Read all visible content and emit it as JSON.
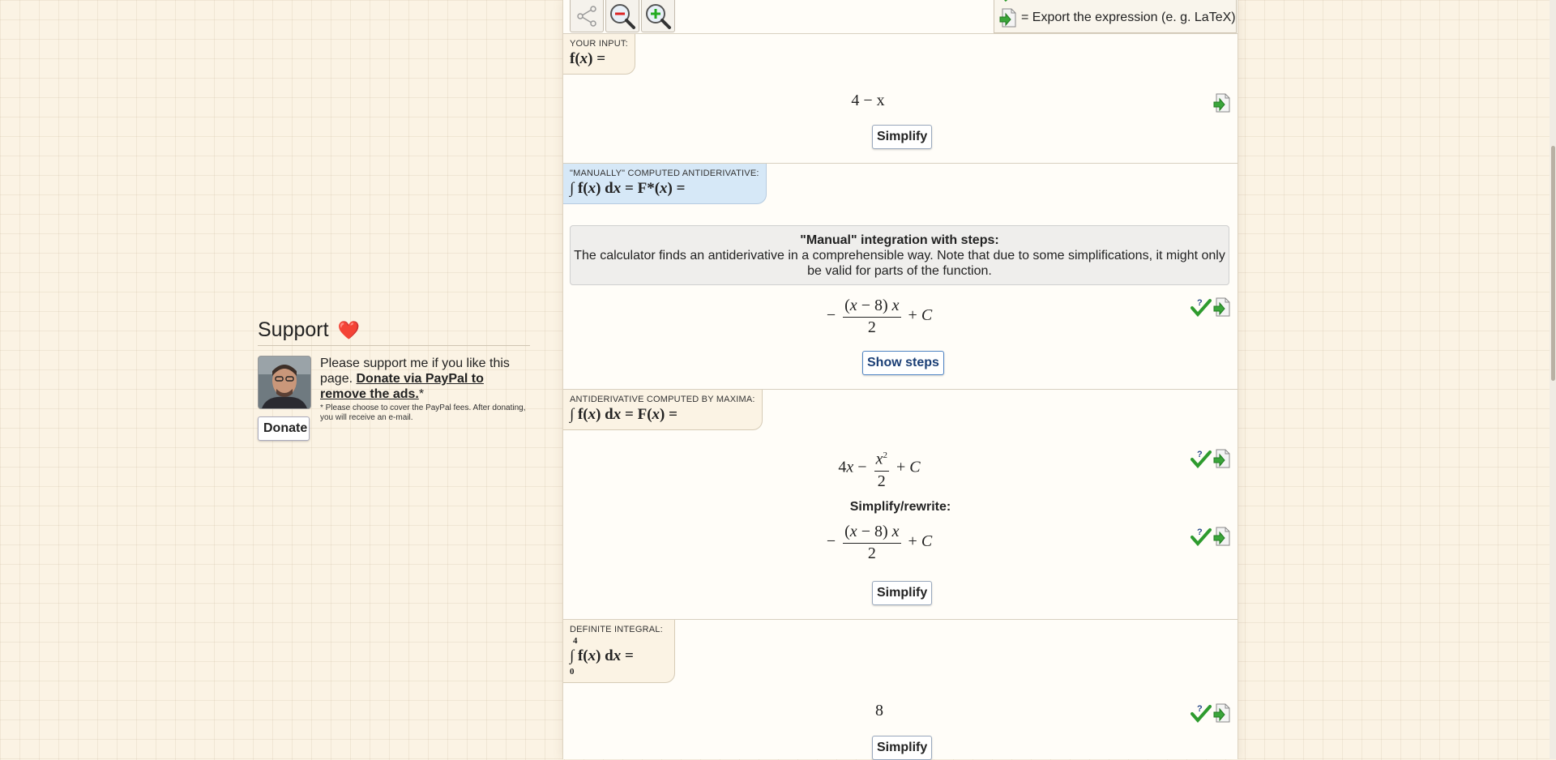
{
  "support": {
    "title": "Support",
    "heart": "❤️",
    "text": "Please support me if you like this page.",
    "link": "Donate via PayPal to remove the ads.",
    "asterisk": "*",
    "note": "* Please choose to cover the PayPal fees. After donating, you will receive an e-mail.",
    "donate_label": "Donate"
  },
  "toolbar": {
    "icons": [
      "share-icon",
      "zoom-out-icon",
      "zoom-in-icon"
    ]
  },
  "legend": {
    "export_text": "= Export the expression (e. g. LaTeX)"
  },
  "input_section": {
    "label": "YOUR INPUT:",
    "expression": "4 − x",
    "simplify_label": "Simplify"
  },
  "manual_section": {
    "label": "\"MANUALLY\" COMPUTED ANTIDERIVATIVE:",
    "info_title": "\"Manual\" integration with steps:",
    "info_text": "The calculator finds an antiderivative in a comprehensible way. Note that due to some simplifications, it might only be valid for parts of the function.",
    "show_steps_label": "Show steps"
  },
  "maxima_section": {
    "label": "ANTIDERIVATIVE COMPUTED BY MAXIMA:",
    "simplify_rewrite_label": "Simplify/rewrite:",
    "simplify_label": "Simplify"
  },
  "definite_section": {
    "label": "DEFINITE INTEGRAL:",
    "lower_limit": "0",
    "upper_limit": "4",
    "result": "8",
    "simplify_label": "Simplify"
  },
  "colors": {
    "background": "#fbf3e4",
    "tab_blue": "#d6e8f7",
    "check_green": "#2e9b2e",
    "button_blue": "#1a3e75"
  }
}
